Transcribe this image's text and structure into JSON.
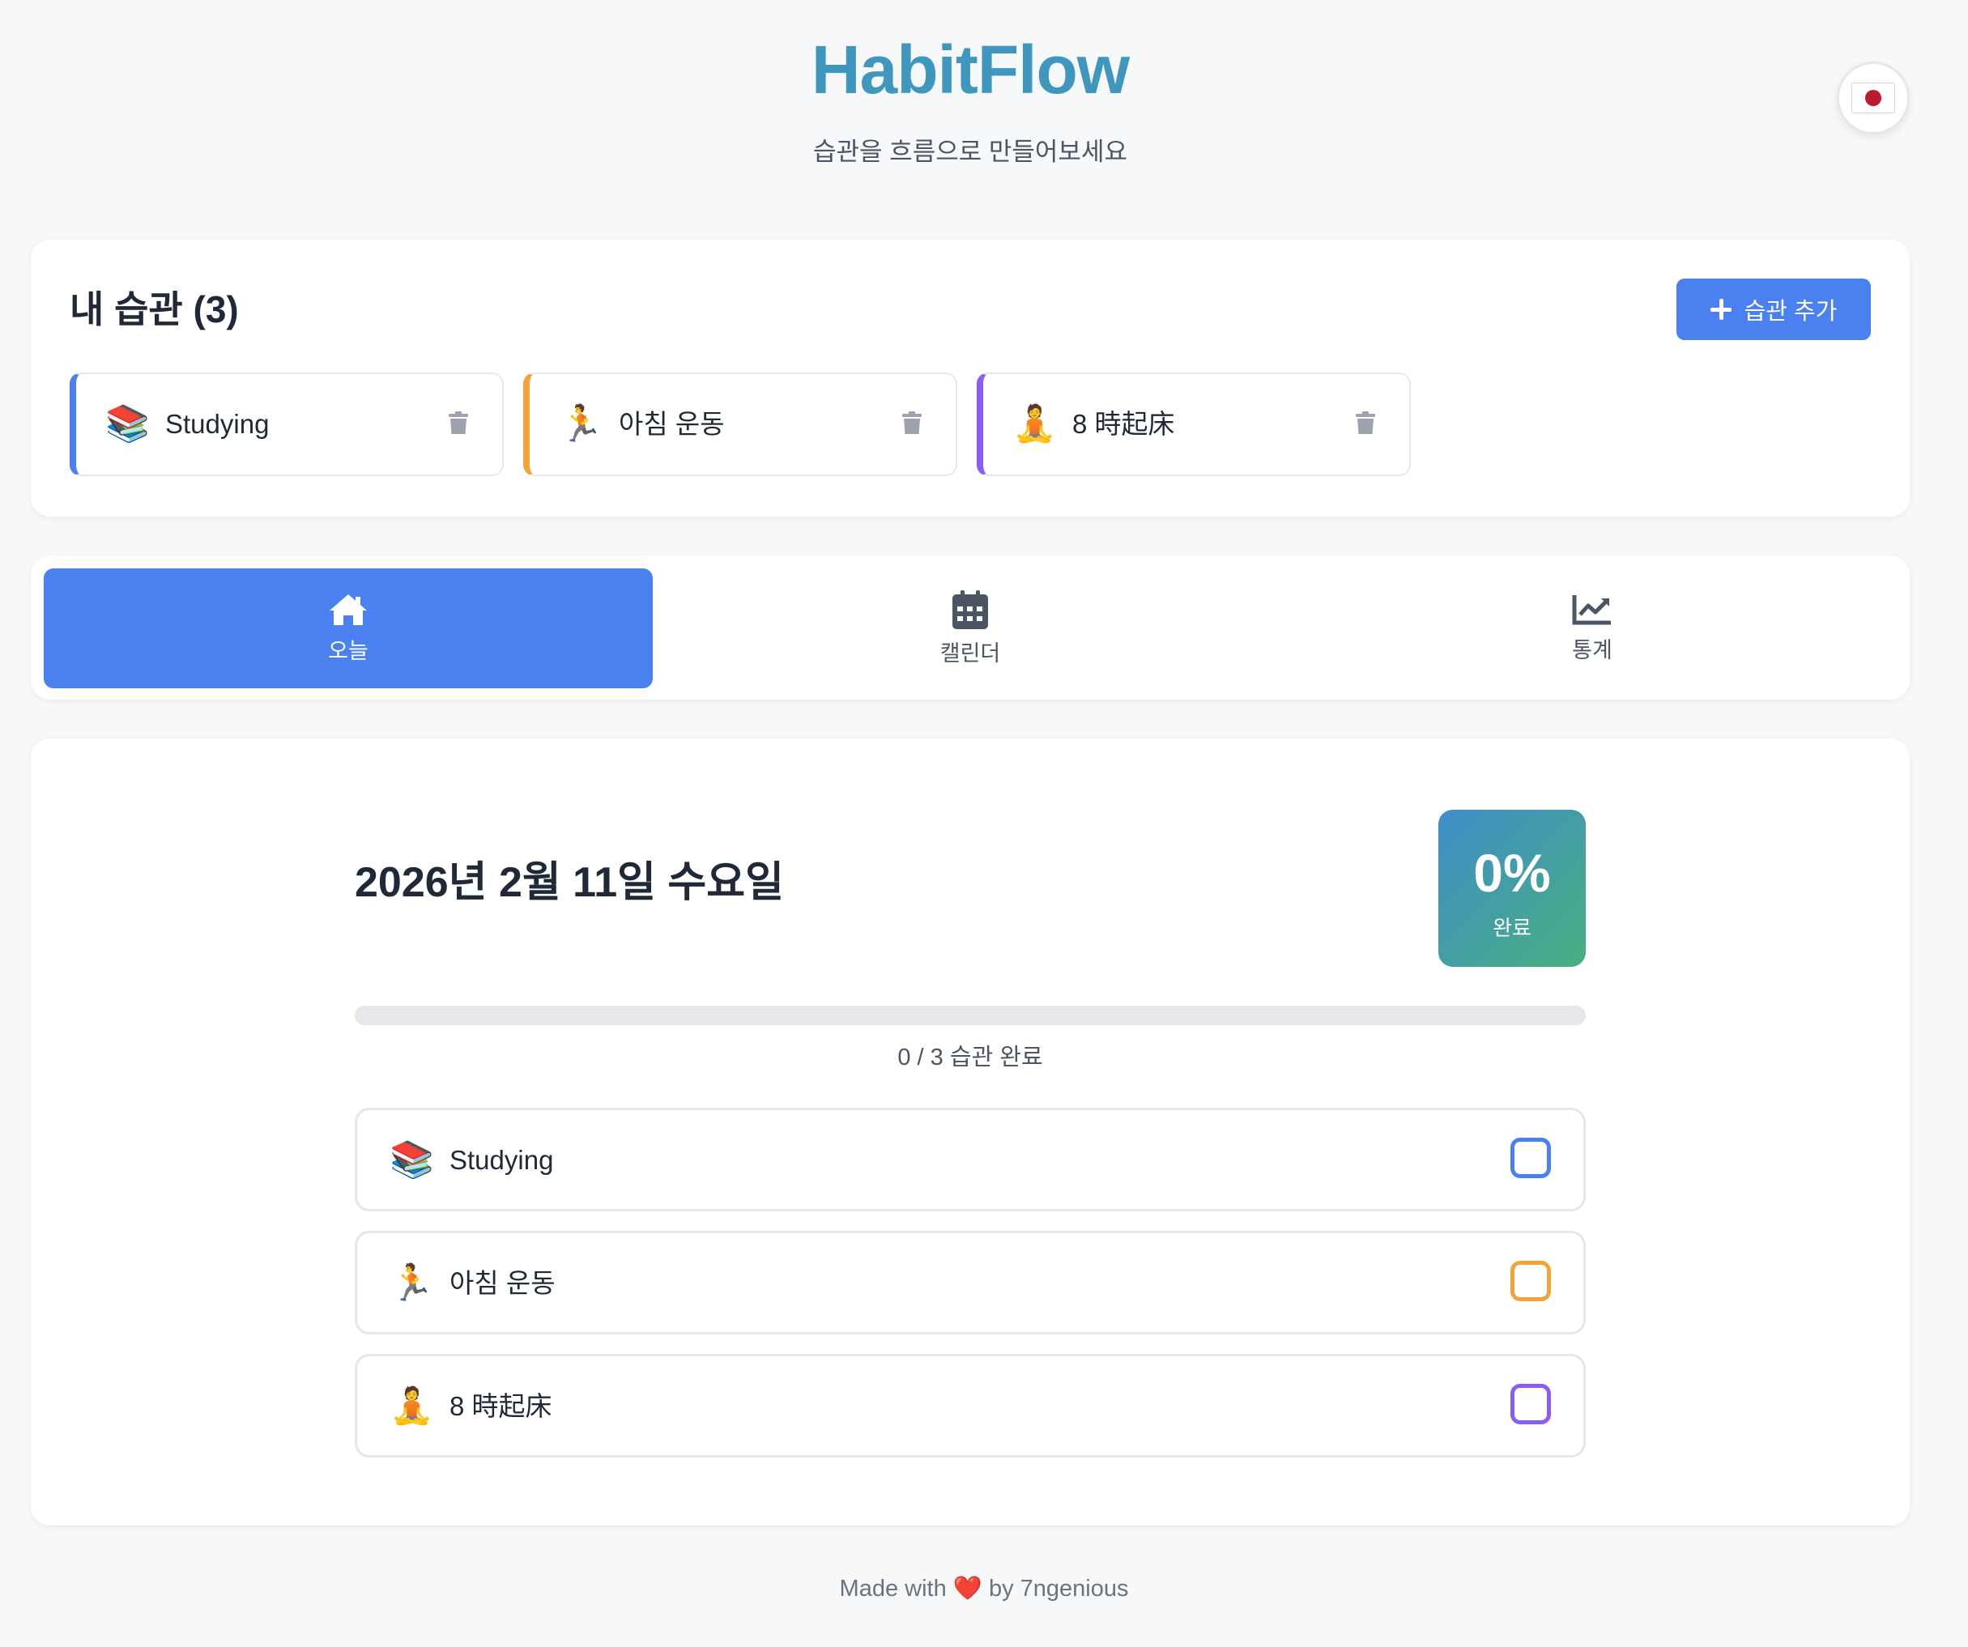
{
  "header": {
    "brand": "HabitFlow",
    "tagline": "습관을 흐름으로 만들어보세요",
    "language_icon": "flag-jp-icon"
  },
  "habits_section": {
    "title": "내 습관 (3)",
    "add_button_label": "습관 추가",
    "items": [
      {
        "emoji": "📚",
        "name": "Studying",
        "color": "#4a80ef"
      },
      {
        "emoji": "🏃",
        "name": "아침 운동",
        "color": "#f2a33a"
      },
      {
        "emoji": "🧘",
        "name": "8 時起床",
        "color": "#8b5cf6"
      }
    ]
  },
  "tabs": [
    {
      "label": "오늘",
      "icon": "home-icon",
      "active": true
    },
    {
      "label": "캘린더",
      "icon": "calendar-icon",
      "active": false
    },
    {
      "label": "통계",
      "icon": "chart-line-icon",
      "active": false
    }
  ],
  "today": {
    "date": "2026년 2월 11일 수요일",
    "completion_percent": "0%",
    "completion_label": "완료",
    "progress_fraction": 0,
    "progress_text": "0 / 3 습관 완료",
    "checklist": [
      {
        "emoji": "📚",
        "name": "Studying",
        "checked": false,
        "color": "#4a80ef"
      },
      {
        "emoji": "🏃",
        "name": "아침 운동",
        "checked": false,
        "color": "#f2a33a"
      },
      {
        "emoji": "🧘",
        "name": "8 時起床",
        "checked": false,
        "color": "#8b5cf6"
      }
    ]
  },
  "footer": {
    "text_before": "Made with",
    "heart": "❤️",
    "text_after": "by 7ngenious"
  },
  "colors": {
    "brand": "#3f97bd",
    "accent": "#4a80ef",
    "badge_gradient_start": "#3f8dc8",
    "badge_gradient_end": "#48b07f"
  }
}
